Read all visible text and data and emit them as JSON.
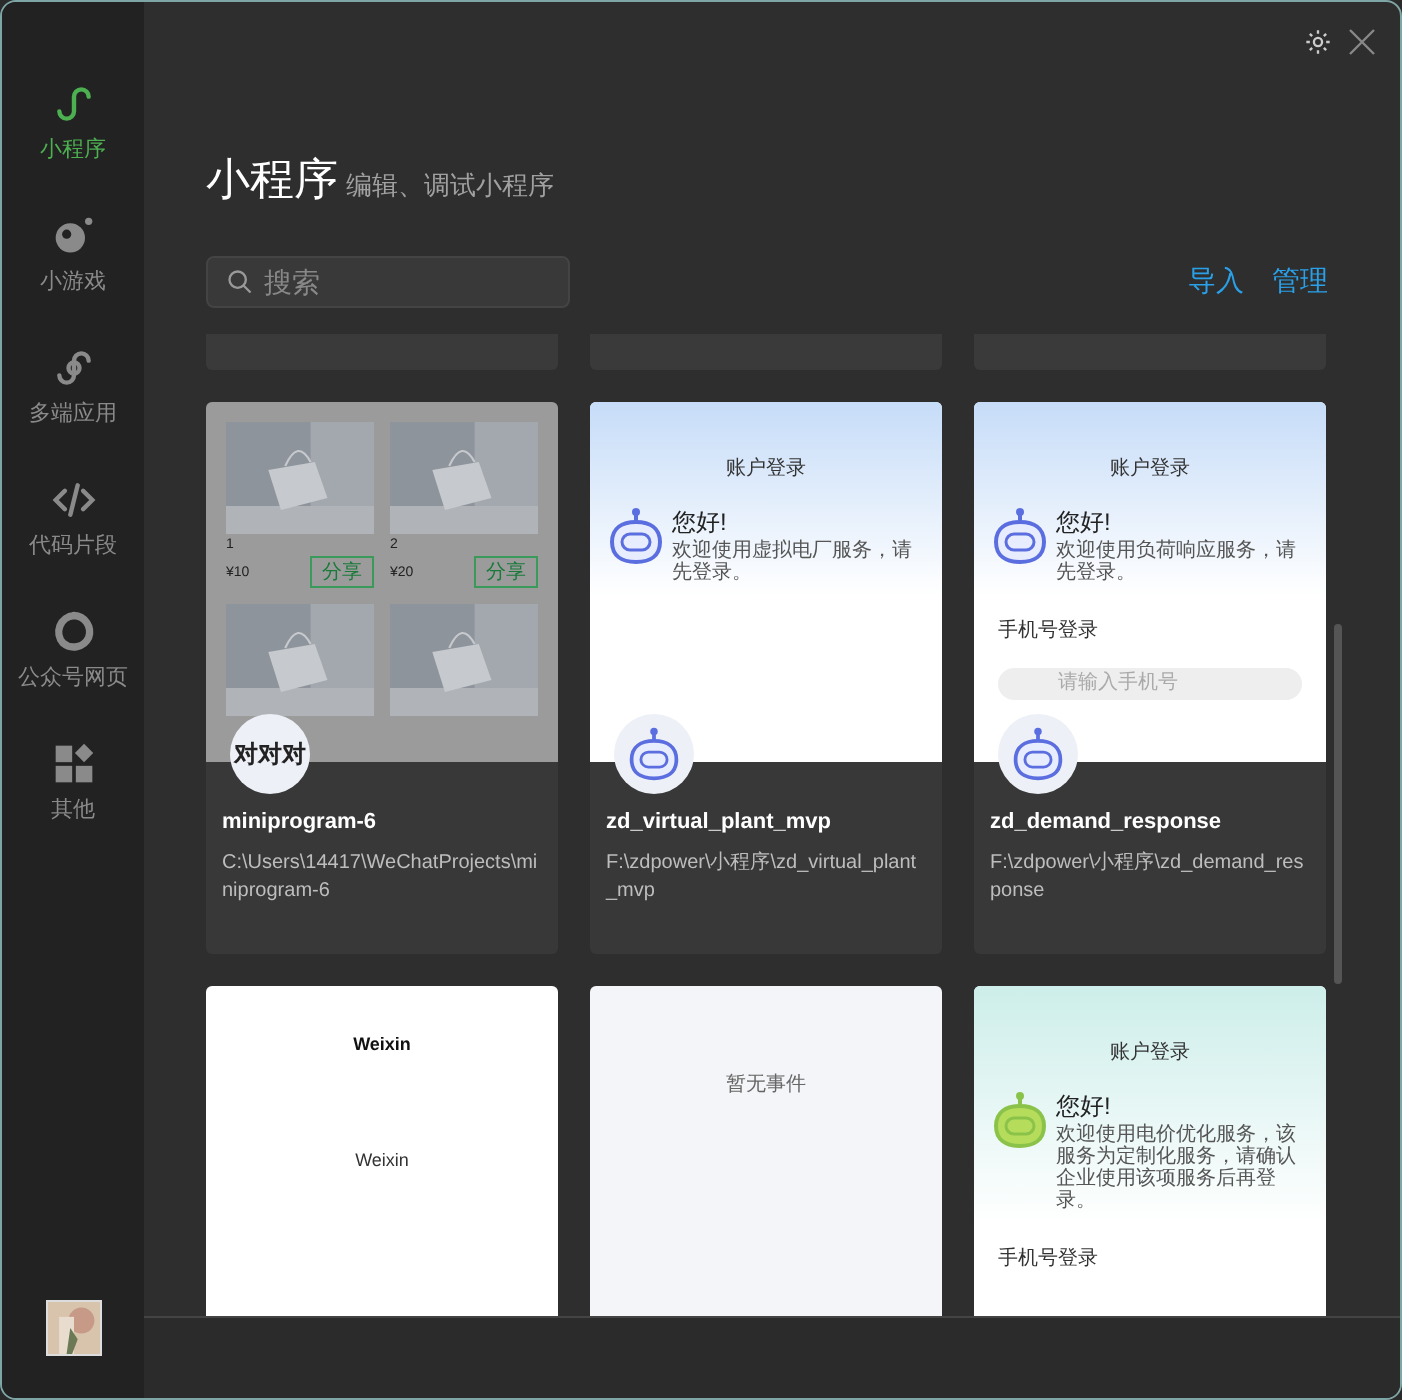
{
  "sidebar": {
    "items": [
      {
        "label": "小程序",
        "selected": true
      },
      {
        "label": "小游戏",
        "selected": false
      },
      {
        "label": "多端应用",
        "selected": false
      },
      {
        "label": "代码片段",
        "selected": false
      },
      {
        "label": "公众号网页",
        "selected": false
      },
      {
        "label": "其他",
        "selected": false
      }
    ]
  },
  "header": {
    "title": "小程序",
    "subtitle": "编辑、调试小程序"
  },
  "search": {
    "placeholder": "搜索"
  },
  "actions": [
    "导入",
    "管理"
  ],
  "projects": [
    {
      "name": "miniprogram-6",
      "path": "C:\\Users\\14417\\WeChatProjects\\miniprogram-6",
      "avatar": {
        "kind": "text",
        "text": "对对对"
      },
      "preview": {
        "kind": "shop",
        "products": [
          {
            "name": "1",
            "price": "¥10",
            "action": "分享"
          },
          {
            "name": "2",
            "price": "¥20",
            "action": "分享"
          },
          {
            "kind": "picture"
          },
          {
            "kind": "picture"
          }
        ]
      }
    },
    {
      "name": "zd_virtual_plant_mvp",
      "path": "F:\\zdpower\\小程序\\zd_virtual_plant_mvp",
      "avatar": {
        "kind": "robot"
      },
      "preview": {
        "kind": "login",
        "title": "账户登录",
        "greeting": "您好!",
        "message": "欢迎使用虚拟电厂服务，请先登录。"
      }
    },
    {
      "name": "zd_demand_response",
      "path": "F:\\zdpower\\小程序\\zd_demand_response",
      "avatar": {
        "kind": "robot"
      },
      "preview": {
        "kind": "login",
        "title": "账户登录",
        "greeting": "您好!",
        "message": "欢迎使用负荷响应服务，请先登录。",
        "form_label": "手机号登录",
        "placeholder": "请输入手机号"
      }
    },
    {
      "preview": {
        "kind": "weixin",
        "title": "Weixin",
        "body": "Weixin"
      }
    },
    {
      "preview": {
        "kind": "empty",
        "text": "暂无事件"
      }
    },
    {
      "preview": {
        "kind": "login",
        "title": "账户登录",
        "greeting": "您好!",
        "message": "欢迎使用电价优化服务，该服务为定制化服务，请确认企业使用该项服务后再登录。",
        "form_label": "手机号登录"
      }
    }
  ]
}
